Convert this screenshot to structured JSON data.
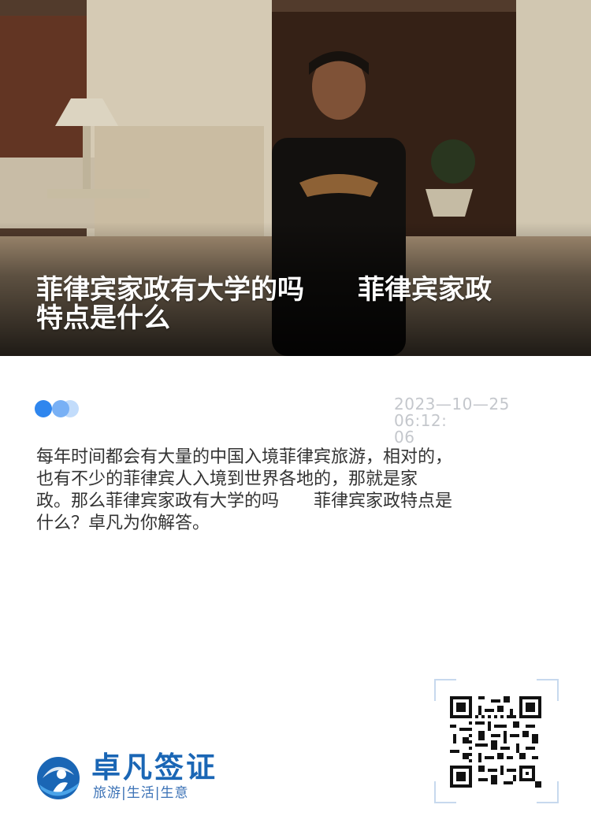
{
  "hero": {
    "title": "菲律宾家政有大学的吗　　菲律宾家政\n特点是什么",
    "photo_icon": "photo-placeholder"
  },
  "meta": {
    "date": "2023—10—25  06:12:\n06",
    "dot_colors": [
      "#2f86ee",
      "#78b0f5",
      "#c2dcfb"
    ]
  },
  "article": {
    "intro": "每年时间都会有大量的中国入境菲律宾旅游，相对的，\n也有不少的菲律宾人入境到世界各地的，那就是家\n政。那么菲律宾家政有大学的吗　　菲律宾家政特点是\n什么？卓凡为你解答。"
  },
  "brand": {
    "name": "卓凡签证",
    "tagline": "旅游|生活|生意",
    "color": "#1a66b5",
    "logo_icon": "globe-person-logo"
  },
  "qr": {
    "icon": "qr-code-icon"
  }
}
